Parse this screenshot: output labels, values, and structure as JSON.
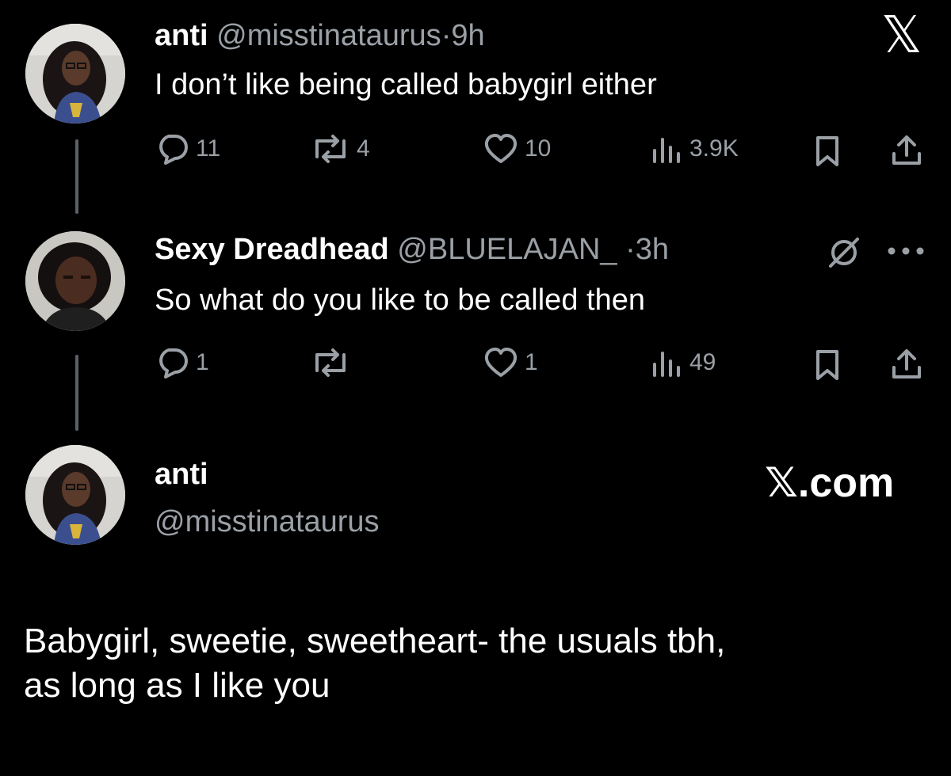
{
  "tweet1": {
    "name": "anti",
    "handle": "@misstinataurus",
    "sep": "·",
    "time": "9h",
    "text": "I don’t like being called babygirl either",
    "replies": "11",
    "reposts": "4",
    "likes": "10",
    "views": "3.9K"
  },
  "tweet2": {
    "name": "Sexy Dreadhead",
    "handle": "@BLUELAJAN_",
    "sep": "·",
    "time": "3h",
    "text": "So what do you like to be called then",
    "replies": "1",
    "reposts": "",
    "likes": "1",
    "views": "49"
  },
  "quote": {
    "name": "anti",
    "handle": "@misstinataurus",
    "brand": "𝕏.com",
    "text_line1": "Babygirl, sweetie, sweetheart- the usuals tbh,",
    "text_line2": "as long as I like you"
  },
  "top_logo": "𝕏",
  "icons": {
    "reply": "reply-icon",
    "repost": "repost-icon",
    "like": "like-icon",
    "views": "views-icon",
    "bookmark": "bookmark-icon",
    "share": "share-icon",
    "more": "more-icon",
    "grok": "grok-icon"
  },
  "colors": {
    "background": "#000000",
    "text": "#ffffff",
    "muted": "#9aa0a6",
    "thread_line": "#5b6066"
  }
}
